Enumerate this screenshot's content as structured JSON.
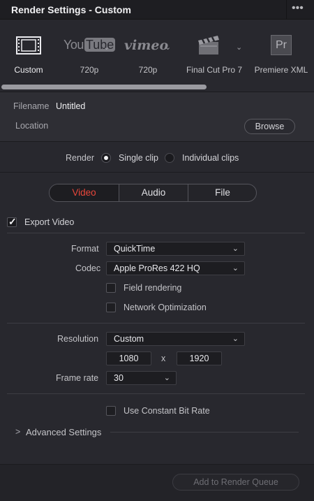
{
  "window": {
    "title": "Render Settings - Custom",
    "more_glyph": "•••"
  },
  "presets": [
    {
      "label": "Custom",
      "icon": "film-strip-icon",
      "active": true
    },
    {
      "label": "720p",
      "icon": "youtube-logo-icon",
      "logo_text_a": "You",
      "logo_text_b": "Tube"
    },
    {
      "label": "720p",
      "icon": "vimeo-logo-icon",
      "logo_text": "vimeo"
    },
    {
      "label": "Final Cut Pro 7",
      "icon": "clapperboard-icon"
    },
    {
      "label": "Premiere XML",
      "icon": "premiere-icon",
      "logo_text": "Pr"
    }
  ],
  "file": {
    "filename_label": "Filename",
    "filename_value": "Untitled",
    "location_label": "Location",
    "browse_label": "Browse"
  },
  "render": {
    "label": "Render",
    "options": [
      {
        "label": "Single clip",
        "selected": true
      },
      {
        "label": "Individual clips",
        "selected": false
      }
    ]
  },
  "tabs": [
    {
      "label": "Video",
      "active": true
    },
    {
      "label": "Audio",
      "active": false
    },
    {
      "label": "File",
      "active": false
    }
  ],
  "video": {
    "export_label": "Export Video",
    "export_checked": true,
    "format_label": "Format",
    "format_value": "QuickTime",
    "codec_label": "Codec",
    "codec_value": "Apple ProRes 422 HQ",
    "field_rendering_label": "Field rendering",
    "field_rendering_checked": false,
    "network_opt_label": "Network Optimization",
    "network_opt_checked": false,
    "resolution_label": "Resolution",
    "resolution_value": "Custom",
    "width_value": "1080",
    "by_glyph": "x",
    "height_value": "1920",
    "framerate_label": "Frame rate",
    "framerate_value": "30",
    "cbr_label": "Use Constant Bit Rate",
    "cbr_checked": false,
    "advanced_label": "Advanced Settings",
    "advanced_glyph": ">"
  },
  "footer": {
    "queue_label": "Add to Render Queue"
  },
  "colors": {
    "accent": "#e8463a",
    "panel": "#28282e",
    "field": "#1d1d21"
  }
}
